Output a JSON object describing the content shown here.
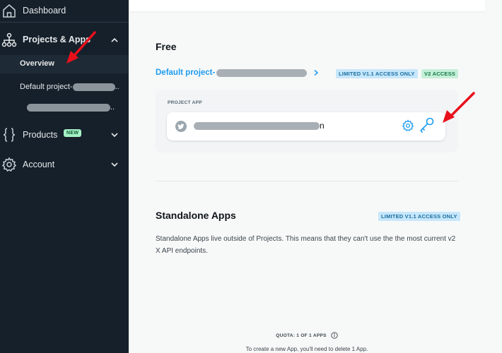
{
  "sidebar": {
    "dashboard_label": "Dashboard",
    "projects_label": "Projects & Apps",
    "overview_label": "Overview",
    "default_project_label": "Default project-",
    "default_project_suffix": "..",
    "second_item_suffix": "..",
    "products_label": "Products",
    "products_badge": "NEW",
    "account_label": "Account"
  },
  "main": {
    "free_heading": "Free",
    "project_link": "Default project-",
    "tag_limited": "LIMITED V1.1 ACCESS ONLY",
    "tag_v2": "V2 ACCESS",
    "project_app_label": "PROJECT APP",
    "app_name_suffix": "n",
    "standalone_heading": "Standalone Apps",
    "standalone_tag": "LIMITED V1.1 ACCESS ONLY",
    "standalone_desc": "Standalone Apps live outside of Projects. This means that they can't use the the most current v2 X API endpoints.",
    "quota_label": "QUOTA: 1 OF 1 APPS",
    "quota_note": "To create a new App, you'll need to delete 1 App."
  },
  "colors": {
    "sidebar_bg": "#15202b",
    "accent": "#1d9bf0",
    "arrow": "#e8101a"
  },
  "icons": {
    "dashboard": "home-icon",
    "projects": "sitemap-icon",
    "products": "braces-icon",
    "account": "gear-icon",
    "app_settings": "gear-icon",
    "app_keys": "key-icon",
    "app_platform": "bird-icon",
    "quota_info": "info-icon"
  }
}
